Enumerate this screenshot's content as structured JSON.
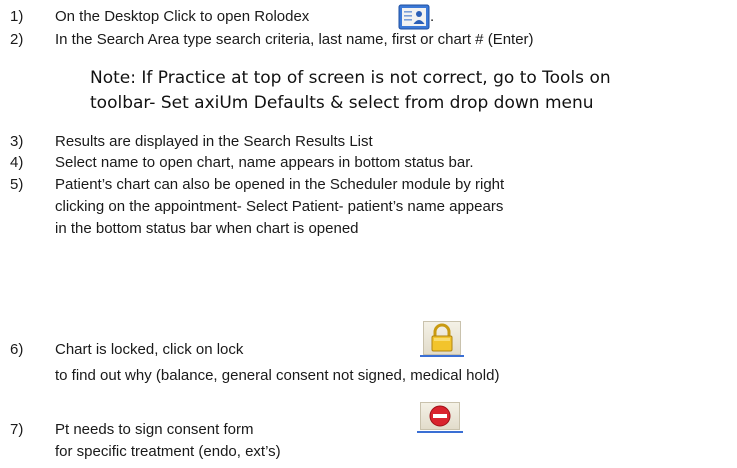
{
  "steps": [
    {
      "num": "1)",
      "lines": [
        "On the Desktop Click to open Rolodex",
        "."
      ]
    },
    {
      "num": "2)",
      "lines": [
        "In the Search Area type search criteria, last name, first or chart # (Enter)"
      ]
    },
    {
      "num": "3)",
      "lines": [
        "Results are displayed in the Search Results List"
      ]
    },
    {
      "num": "4)",
      "lines": [
        "Select name to open chart, name appears in bottom status bar."
      ]
    },
    {
      "num": "5)",
      "lines": [
        "Patient’s chart can also be opened in the Scheduler module by right",
        "clicking on the appointment- Select Patient- patient’s name appears",
        "in the bottom status bar when chart is opened"
      ]
    },
    {
      "num": "6)",
      "lines": [
        "Chart is locked, click on lock",
        "to find out why (balance, general consent not signed, medical  hold)"
      ]
    },
    {
      "num": "7)",
      "lines": [
        "Pt needs to sign consent form",
        "for specific treatment (endo, ext’s)"
      ]
    }
  ],
  "note": {
    "line1": "Note: If Practice at top of screen is not correct, go to Tools on",
    "line2": "toolbar- Set axiUm Defaults & select from drop down menu"
  },
  "icons": {
    "rolodex": "rolodex-card-icon",
    "lock": "padlock-icon",
    "consent": "stop-sign-icon"
  },
  "colors": {
    "icon_blue": "#2f6fd0",
    "lock_gold": "#e6b820",
    "stop_red": "#d9232e"
  }
}
